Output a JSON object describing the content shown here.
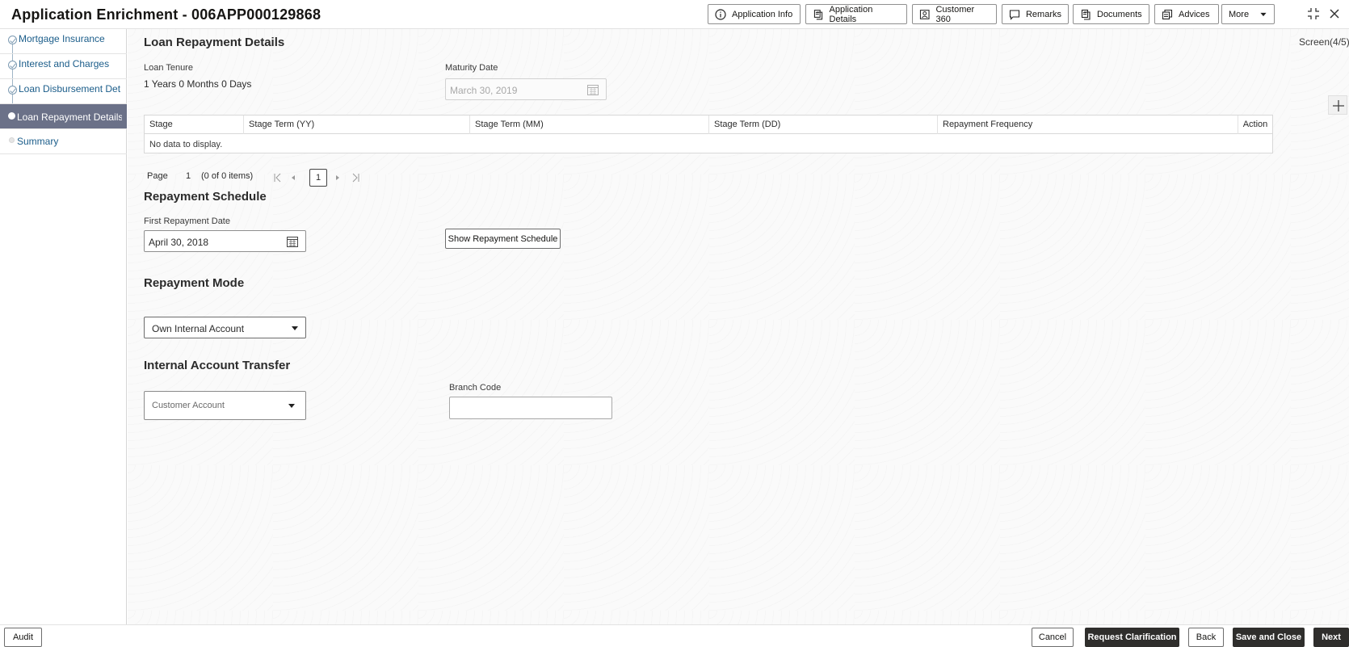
{
  "header": {
    "title": "Application Enrichment - 006APP000129868",
    "buttons": [
      {
        "label": "Application Info",
        "icon": "info-icon"
      },
      {
        "label": "Application Details",
        "icon": "document-icon"
      },
      {
        "label": "Customer 360",
        "icon": "user-card-icon"
      },
      {
        "label": "Remarks",
        "icon": "comment-icon"
      },
      {
        "label": "Documents",
        "icon": "document-icon"
      },
      {
        "label": "Advices",
        "icon": "advices-icon"
      }
    ],
    "more_label": "More"
  },
  "sidebar": {
    "items": [
      {
        "label": "Mortgage Insurance",
        "state": "done"
      },
      {
        "label": "Interest and Charges",
        "state": "done"
      },
      {
        "label": "Loan Disbursement Det ...",
        "state": "done"
      },
      {
        "label": "Loan Repayment Details",
        "state": "active"
      },
      {
        "label": "Summary",
        "state": "pending"
      }
    ]
  },
  "main": {
    "section_title": "Loan Repayment Details",
    "screen_counter": "Screen(4/5)",
    "loan_tenure": {
      "label": "Loan Tenure",
      "value": "1 Years 0 Months 0 Days"
    },
    "maturity_date": {
      "label": "Maturity Date",
      "value": "March 30, 2019"
    },
    "table": {
      "columns": [
        "Stage",
        "Stage Term (YY)",
        "Stage Term (MM)",
        "Stage Term (DD)",
        "Repayment Frequency",
        "Action"
      ],
      "empty_text": "No data to display."
    },
    "pager": {
      "page_label": "Page",
      "page_number": "1",
      "items_text": "(0 of 0 items)",
      "current_page": "1"
    },
    "repayment_schedule": {
      "title": "Repayment Schedule",
      "first_date_label": "First Repayment Date",
      "first_date_value": "April 30, 2018",
      "show_button": "Show Repayment Schedule"
    },
    "repayment_mode": {
      "title": "Repayment Mode",
      "selected": "Own Internal Account"
    },
    "internal_transfer": {
      "title": "Internal Account Transfer",
      "account_placeholder": "Customer Account",
      "branch_code_label": "Branch Code",
      "branch_code_value": ""
    }
  },
  "footer": {
    "audit": "Audit",
    "cancel": "Cancel",
    "request_clarification": "Request Clarification",
    "back": "Back",
    "save_close": "Save and Close",
    "next": "Next"
  }
}
